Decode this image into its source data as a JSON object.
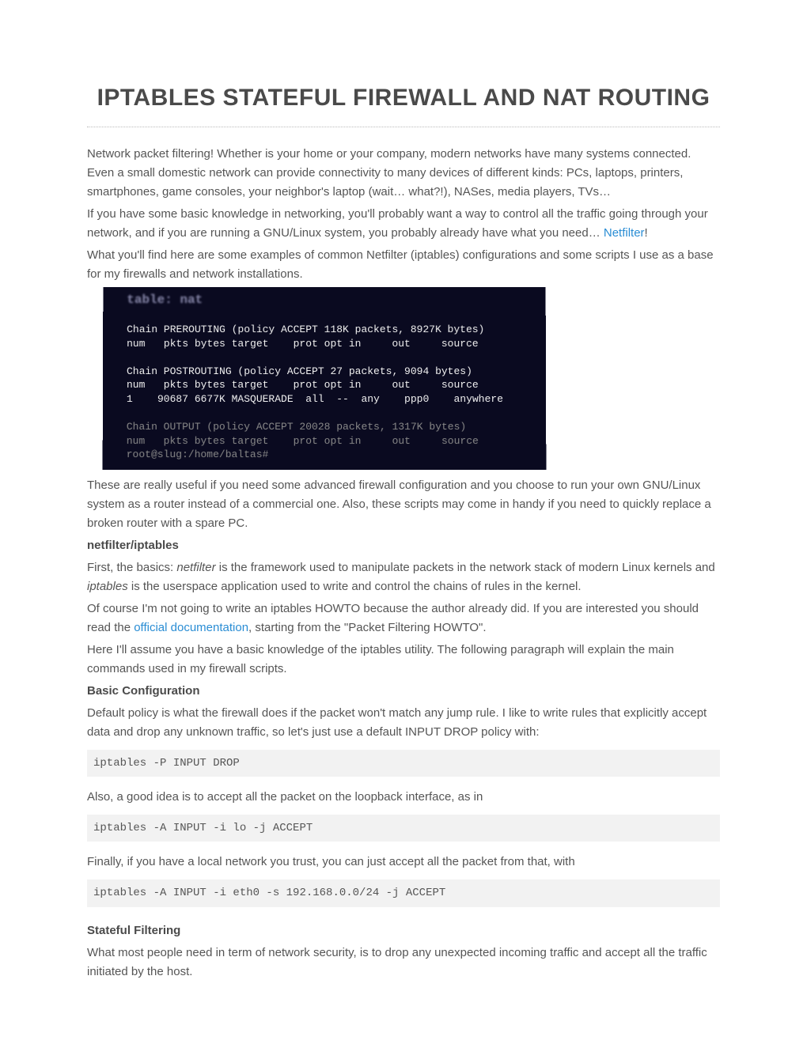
{
  "title": "IPTABLES STATEFUL FIREWALL AND NAT ROUTING",
  "para1": "Network packet filtering! Whether is your home or your company, modern networks have many systems connected. Even a small domestic network can provide connectivity to many devices of different kinds: PCs, laptops, printers, smartphones, game consoles, your neighbor's laptop (wait… what?!), NASes, media players, TVs…",
  "para2_pre": "If you have some basic knowledge in networking, you'll probably want a way to control all the traffic going through your network, and if you are running a GNU/Linux system, you probably already have what you need… ",
  "para2_link": "Netfilter",
  "para2_post": "!",
  "para3": "What you'll find here are some examples of common Netfilter (iptables) configurations and some scripts I use as a base for my firewalls and network installations.",
  "figure": {
    "l0": "table: nat",
    "l1": "Chain PREROUTING (policy ACCEPT 118K packets, 8927K bytes)",
    "l2": "num   pkts bytes target    prot opt in     out     source",
    "l3": "Chain POSTROUTING (policy ACCEPT 27 packets, 9094 bytes)",
    "l4": "num   pkts bytes target    prot opt in     out     source",
    "l5": "1    90687 6677K MASQUERADE  all  --  any    ppp0    anywhere",
    "l6": "Chain OUTPUT (policy ACCEPT 20028 packets, 1317K bytes)",
    "l7": "num   pkts bytes target    prot opt in     out     source",
    "l8": "root@slug:/home/baltas#"
  },
  "para4": "These are really useful if you need some advanced firewall configuration and you choose to run your own GNU/Linux system as a router instead of a commercial one. Also, these scripts may come in handy if you need to quickly replace a broken router with a spare PC.",
  "h2a": "netfilter/iptables",
  "para5_pre": "First, the basics: ",
  "para5_em1": "netfilter",
  "para5_mid": " is the framework used to manipulate packets in the network stack of modern Linux kernels and ",
  "para5_em2": "iptables",
  "para5_post": " is the userspace application used to write and control the chains of rules in the kernel.",
  "para6_pre": "Of course I'm not going to write an iptables HOWTO because the author already did. If you are interested you should read the ",
  "para6_link": "official documentation",
  "para6_post": ", starting from the \"Packet Filtering HOWTO\".",
  "para7": "Here I'll assume you have a basic knowledge of the iptables utility. The following paragraph will explain the main commands used in my firewall scripts.",
  "h2b": "Basic Configuration",
  "para8": "Default policy is what the firewall does if the packet won't match any jump rule. I like to write rules that explicitly accept data and drop any unknown traffic, so let's just use a default INPUT DROP policy with:",
  "code1": "iptables -P INPUT DROP",
  "para9": "Also, a good idea is to accept all the packet on the loopback interface, as in",
  "code2": "iptables -A INPUT -i lo -j ACCEPT",
  "para10": "Finally, if you have a local network you trust, you can just accept all the packet from that, with",
  "code3": "iptables -A INPUT -i eth0 -s 192.168.0.0/24 -j ACCEPT",
  "h2c": "Stateful Filtering",
  "para11": "What most people need in term of network security, is to drop any unexpected incoming traffic and accept all the traffic initiated by the host."
}
